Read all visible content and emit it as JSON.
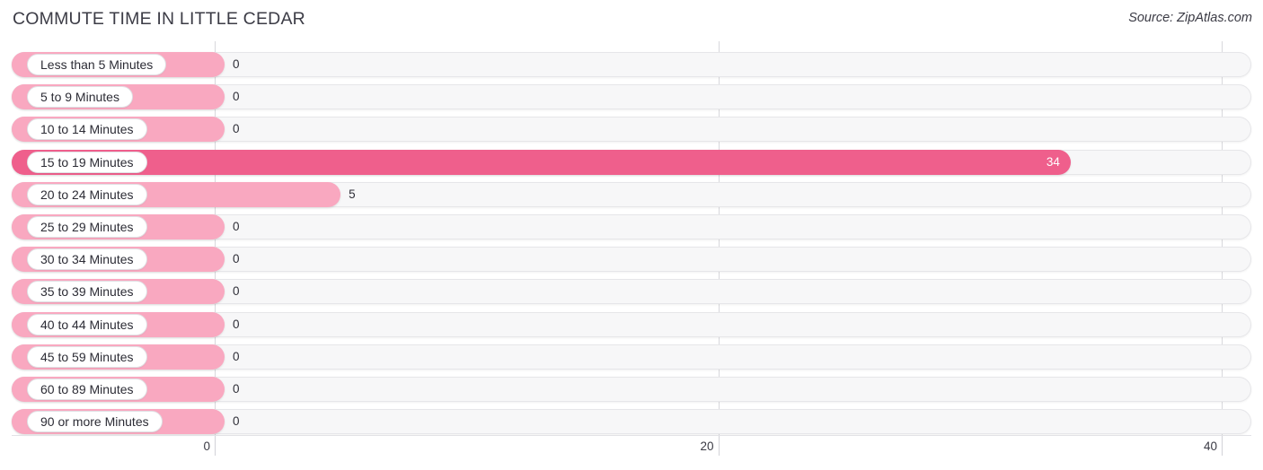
{
  "header": {
    "title": "COMMUTE TIME IN LITTLE CEDAR",
    "source": "Source: ZipAtlas.com"
  },
  "colors": {
    "bar": "#f9a8c0",
    "bar_highlight": "#ef5f8c",
    "track": "#f7f7f8",
    "gridline": "#d8d8dc",
    "text": "#2f2f38"
  },
  "chart_data": {
    "type": "bar",
    "orientation": "horizontal",
    "title": "COMMUTE TIME IN LITTLE CEDAR",
    "xlabel": "",
    "ylabel": "",
    "xlim": [
      0,
      40
    ],
    "xticks": [
      0,
      20,
      40
    ],
    "xtick_labels": [
      "0",
      "20",
      "40"
    ],
    "grid": true,
    "legend": false,
    "categories": [
      "Less than 5 Minutes",
      "5 to 9 Minutes",
      "10 to 14 Minutes",
      "15 to 19 Minutes",
      "20 to 24 Minutes",
      "25 to 29 Minutes",
      "30 to 34 Minutes",
      "35 to 39 Minutes",
      "40 to 44 Minutes",
      "45 to 59 Minutes",
      "60 to 89 Minutes",
      "90 or more Minutes"
    ],
    "values": [
      0,
      0,
      0,
      34,
      5,
      0,
      0,
      0,
      0,
      0,
      0,
      0
    ],
    "value_labels": [
      "0",
      "0",
      "0",
      "34",
      "5",
      "0",
      "0",
      "0",
      "0",
      "0",
      "0",
      "0"
    ],
    "highlight_index": 3
  }
}
